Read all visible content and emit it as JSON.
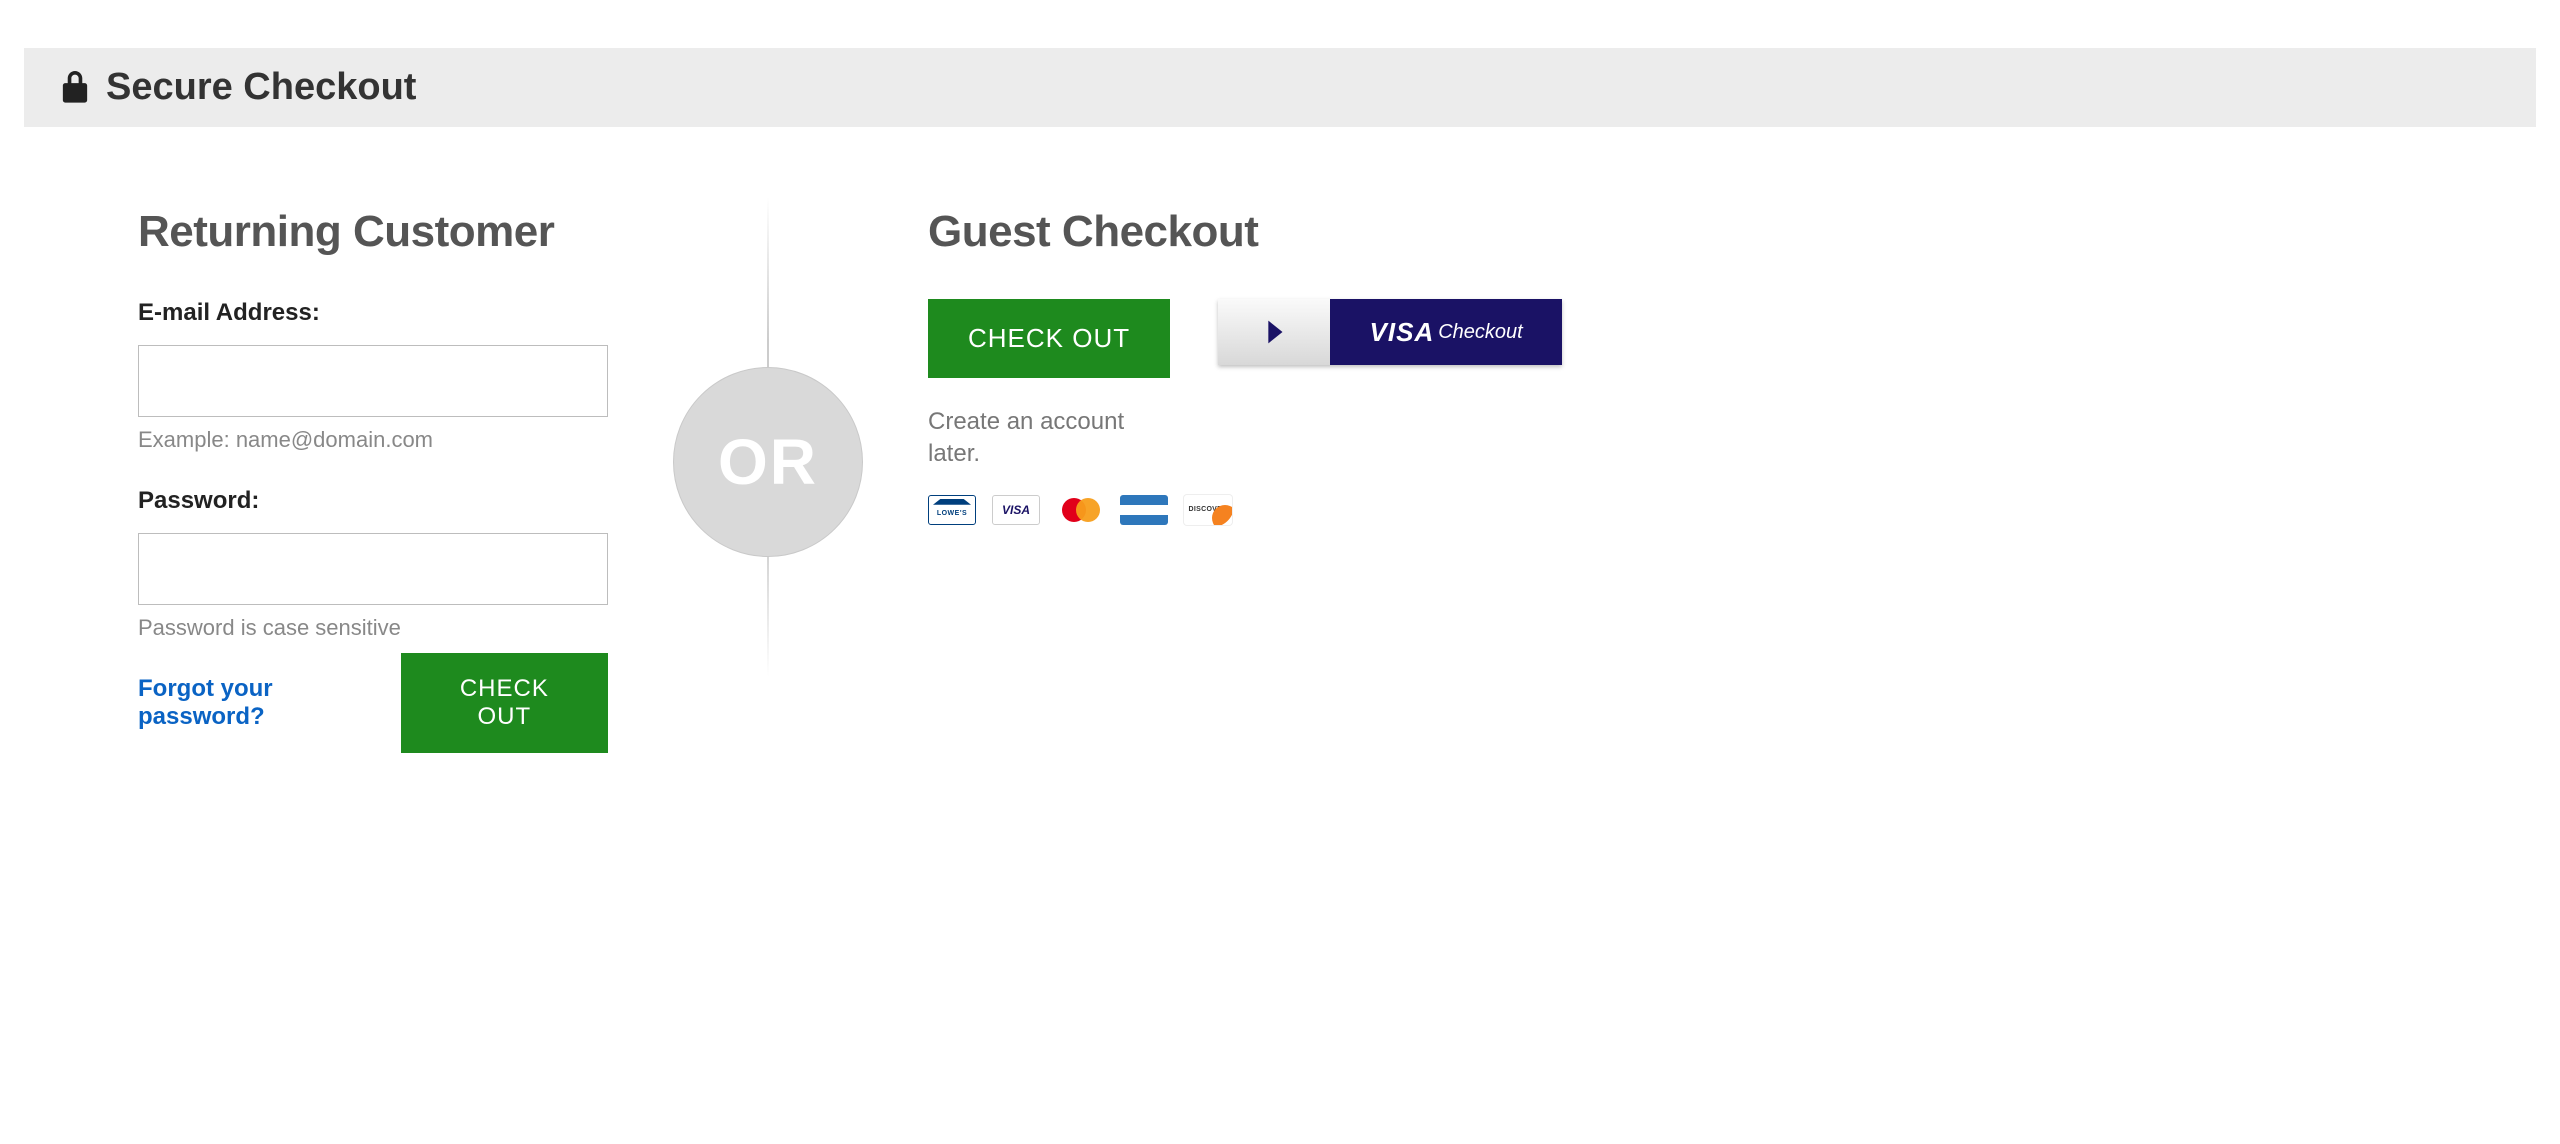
{
  "header": {
    "title": "Secure Checkout"
  },
  "returning": {
    "title": "Returning Customer",
    "email_label": "E-mail Address:",
    "email_value": "",
    "email_hint": "Example: name@domain.com",
    "password_label": "Password:",
    "password_value": "",
    "password_hint": "Password is case sensitive",
    "forgot_link": "Forgot your password?",
    "checkout_button": "CHECK OUT"
  },
  "divider": {
    "or_label": "OR"
  },
  "guest": {
    "title": "Guest Checkout",
    "checkout_button": "CHECK OUT",
    "visa_brand": "VISA",
    "visa_checkout_word": "Checkout",
    "later_note": "Create an account later.",
    "cards": {
      "lowes": "LOWE'S",
      "visa": "VISA",
      "mastercard": "mastercard",
      "amex": "AMEX",
      "discover": "DISCOVER"
    }
  }
}
